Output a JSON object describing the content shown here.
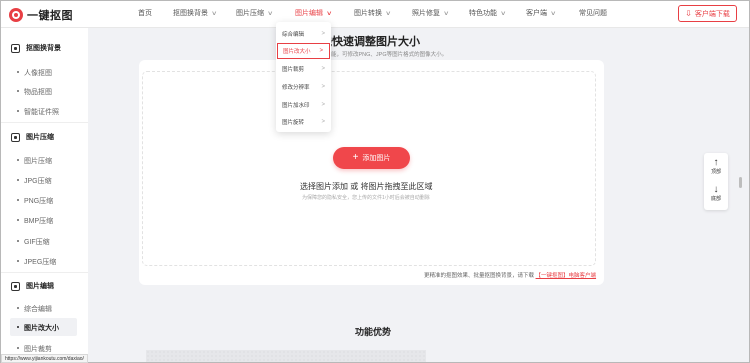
{
  "header": {
    "logo_text": "一键抠图",
    "nav": [
      {
        "label": "首页",
        "chevron": false
      },
      {
        "label": "抠图换背景",
        "chevron": true
      },
      {
        "label": "图片压缩",
        "chevron": true
      },
      {
        "label": "图片编辑",
        "chevron": true,
        "active": true
      },
      {
        "label": "图片转换",
        "chevron": true
      },
      {
        "label": "照片修复",
        "chevron": true
      },
      {
        "label": "特色功能",
        "chevron": true
      },
      {
        "label": "客户端",
        "chevron": true
      },
      {
        "label": "常见问题",
        "chevron": false
      }
    ],
    "download_button": "客户端下载",
    "accent_color": "#e83f44"
  },
  "dropdown": {
    "items": [
      {
        "label": "综合编辑"
      },
      {
        "label": "图片改大小",
        "highlighted": true
      },
      {
        "label": "图片裁剪"
      },
      {
        "label": "修改分辨率"
      },
      {
        "label": "图片加水印"
      },
      {
        "label": "图片旋转"
      }
    ]
  },
  "sidebar": {
    "sections": [
      {
        "title": "抠图换背景",
        "items": [
          "人像抠图",
          "物品抠图",
          "智能证件照"
        ]
      },
      {
        "title": "图片压缩",
        "items": [
          "图片压缩",
          "JPG压缩",
          "PNG压缩",
          "BMP压缩",
          "GIF压缩",
          "JPEG压缩"
        ]
      },
      {
        "title": "图片编辑",
        "items": [
          "综合编辑",
          "图片改大小",
          "图片裁剪"
        ]
      }
    ],
    "selected_item": "图片改大小"
  },
  "main": {
    "title": "在线快速调整图片大小",
    "subtitle": "小功能，可修改PNG、JPG等图片格式的图像大小。",
    "add_button": "添加图片",
    "drop_text": "选择图片添加 或 将图片拖拽至此区域",
    "privacy_text": "为保障您的隐私安全，您上传的文件1小时后会被自动删除",
    "footnote_prefix": "更精准的抠图效果、批量抠图换背景，请下载",
    "footnote_link": "【一键抠图】电脑客户端",
    "features_title": "功能优势"
  },
  "float": {
    "top_label": "顶部",
    "bottom_label": "底部"
  },
  "status_url": "https://www.yijiankoutu.com/daxiao/"
}
